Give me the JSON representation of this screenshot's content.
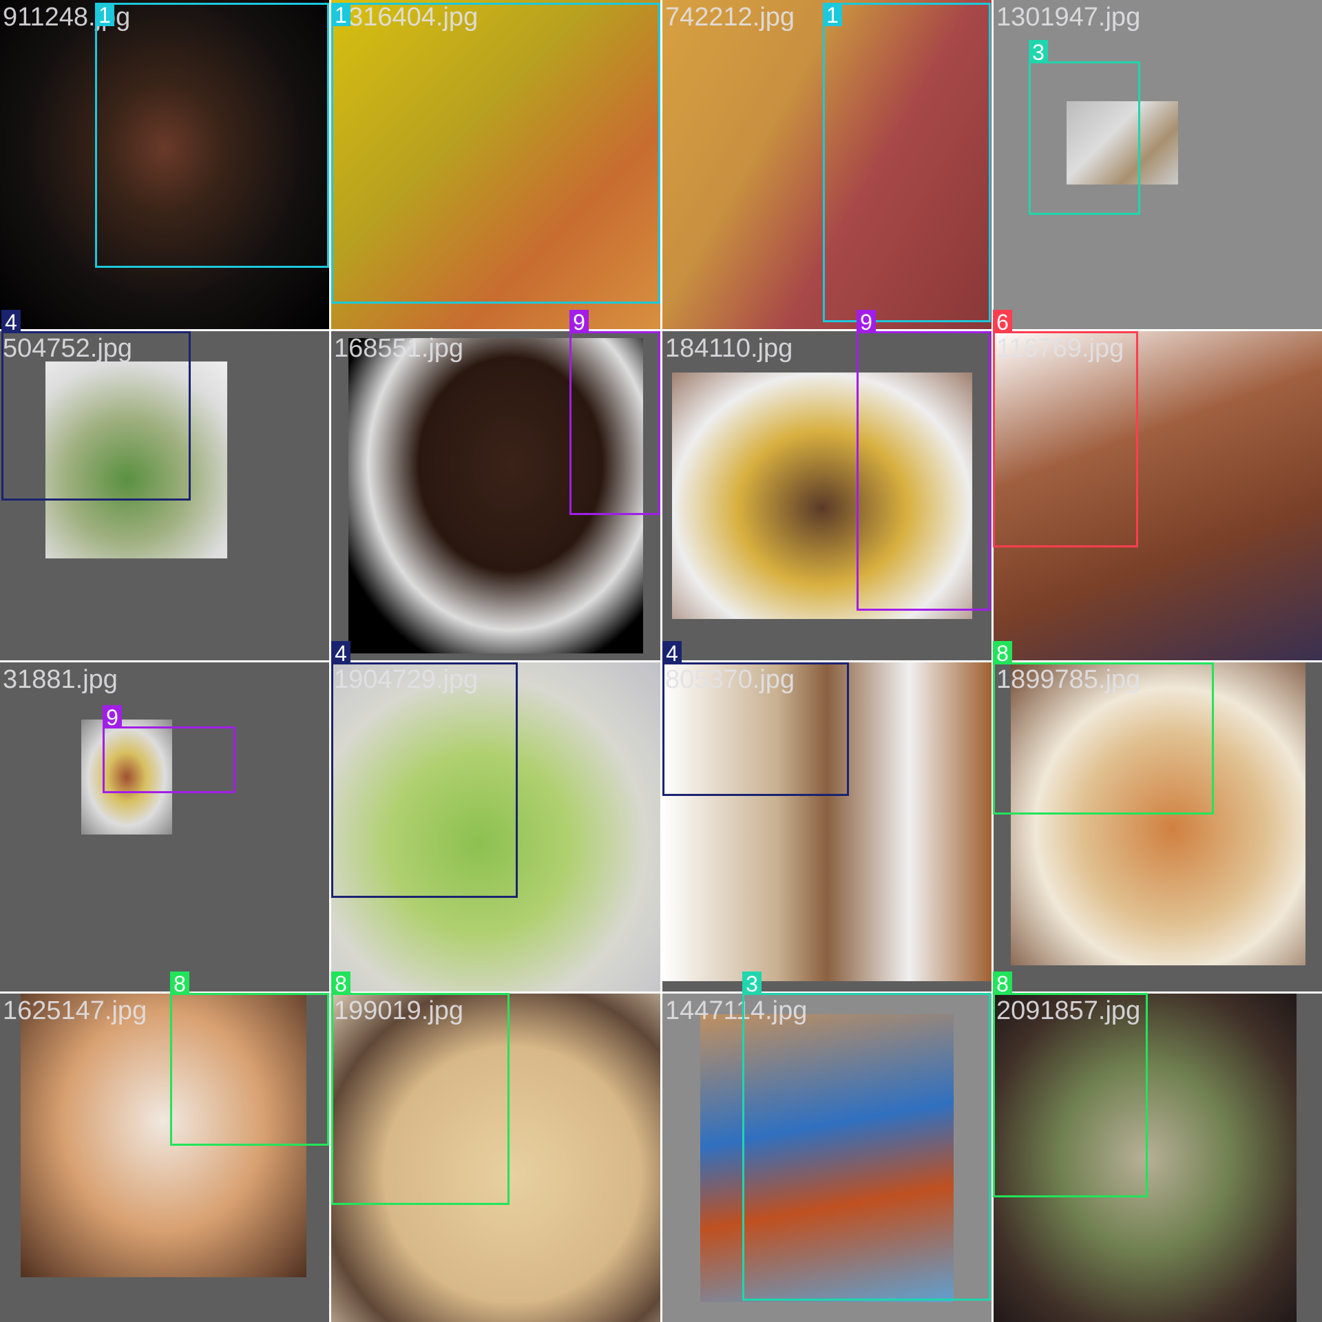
{
  "colors": {
    "class_1": "#1cc8dc",
    "class_3": "#1fd6ad",
    "class_4": "#1a2370",
    "class_6": "#ff3d4f",
    "class_8": "#21e45a",
    "class_9": "#a21ee8"
  },
  "tiles": [
    {
      "filename": "911248.jpg",
      "boxes": [
        {
          "label": "1"
        }
      ]
    },
    {
      "filename": "1316404.jpg",
      "boxes": [
        {
          "label": "1"
        }
      ]
    },
    {
      "filename": "742212.jpg",
      "boxes": [
        {
          "label": "1"
        }
      ]
    },
    {
      "filename": "1301947.jpg",
      "boxes": [
        {
          "label": "3"
        }
      ]
    },
    {
      "filename": "504752.jpg",
      "boxes": [
        {
          "label": "4"
        }
      ]
    },
    {
      "filename": "168551.jpg",
      "boxes": [
        {
          "label": "9"
        }
      ]
    },
    {
      "filename": "184110.jpg",
      "boxes": [
        {
          "label": "9"
        }
      ]
    },
    {
      "filename": "116769.jpg",
      "boxes": [
        {
          "label": "6"
        }
      ]
    },
    {
      "filename": "31881.jpg",
      "boxes": [
        {
          "label": "9"
        }
      ]
    },
    {
      "filename": "1904729.jpg",
      "boxes": [
        {
          "label": "4"
        }
      ]
    },
    {
      "filename": "805370.jpg",
      "boxes": [
        {
          "label": "4"
        }
      ]
    },
    {
      "filename": "1899785.jpg",
      "boxes": [
        {
          "label": "8"
        }
      ]
    },
    {
      "filename": "1625147.jpg",
      "boxes": [
        {
          "label": "8"
        }
      ]
    },
    {
      "filename": "199019.jpg",
      "boxes": [
        {
          "label": "8"
        }
      ]
    },
    {
      "filename": "1447114.jpg",
      "boxes": [
        {
          "label": "3"
        }
      ]
    },
    {
      "filename": "2091857.jpg",
      "boxes": [
        {
          "label": "8"
        }
      ]
    }
  ]
}
